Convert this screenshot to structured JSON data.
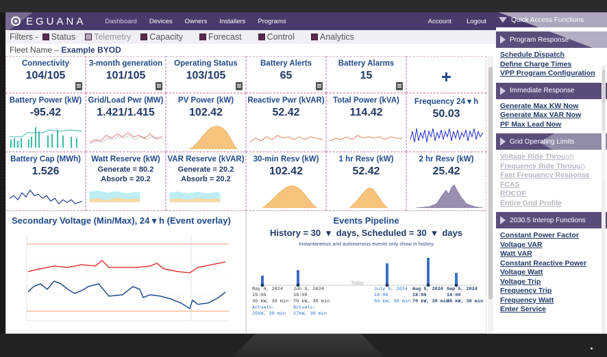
{
  "nav": {
    "logo": "EGUANA",
    "items": [
      "Dashboard",
      "Devices",
      "Owners",
      "Installers",
      "Programs"
    ],
    "account": "Account",
    "logout": "Logout"
  },
  "filters": {
    "label": "Filters -",
    "items": [
      {
        "label": "Status",
        "checked": true
      },
      {
        "label": "Telemetry",
        "checked": false
      },
      {
        "label": "Capacity",
        "checked": true
      },
      {
        "label": "Forecast",
        "checked": true
      },
      {
        "label": "Control",
        "checked": true
      },
      {
        "label": "Analytics",
        "checked": true
      }
    ]
  },
  "fleet": {
    "label": "Fleet Name –",
    "name": "Example BYOD"
  },
  "tiles_row1": [
    {
      "title": "Connectivity",
      "value": "104/105"
    },
    {
      "title": "3-month generation",
      "value": "101/105"
    },
    {
      "title": "Operating Status",
      "value": "103/105"
    },
    {
      "title": "Battery Alerts",
      "value": "65"
    },
    {
      "title": "Battery Alarms",
      "value": "15"
    },
    {
      "title": "",
      "value": "+"
    }
  ],
  "tiles_row2": [
    {
      "title": "Battery Power (kW)",
      "value": "-95.42"
    },
    {
      "title": "Grid/Load Pwr (MW)",
      "value": "1.421/1.415"
    },
    {
      "title": "PV Power (kW)",
      "value": "102.42"
    },
    {
      "title": "Reactive Pwr (kVAR)",
      "value": "52.42"
    },
    {
      "title": "Total Power (kVA)",
      "value": "114.42"
    },
    {
      "title": "Frequency 24 ▾ h",
      "value": "50.03"
    }
  ],
  "tiles_row3": [
    {
      "title": "Battery Cap (MWh)",
      "value": "1.526"
    },
    {
      "title": "Watt Reserve (kW)",
      "line1": "Generate = 80.2",
      "line2": "Absorb = 20.2"
    },
    {
      "title": "VAR Reserve (kVAR)",
      "line1": "Generate = 20.2",
      "line2": "Absorb = 20.2"
    },
    {
      "title": "30-min Resv (kW)",
      "value": "102.42"
    },
    {
      "title": "1 hr Resv (kW)",
      "value": "52.42"
    },
    {
      "title": "2 hr Resv (kW)",
      "value": "25.42"
    }
  ],
  "voltage_panel": {
    "title": "Secondary Voltage (Min/Max), 24 ▾ h (Event overlay)"
  },
  "events": {
    "title": "Events Pipeline",
    "history_label": "History = 30",
    "history_unit": "days, Scheduled = 30",
    "scheduled_unit": "days",
    "note": "Instantaneous and autonomous events only show in history",
    "today": "Today",
    "items": [
      {
        "date": "May 4, 2024",
        "time": "19:00",
        "detail": "30 kW, 30 min",
        "actuals_label": "Actuals:",
        "actuals": "25kW, 30 min"
      },
      {
        "date": "Jun 5, 2024",
        "time": "18:00",
        "detail": "70 kW, 30 min",
        "actuals_label": "Actuals:",
        "actuals": "27kW, 30 min"
      },
      {
        "date": "July 5, 2024",
        "time": "18:00",
        "detail": "50 kW, 30 min"
      },
      {
        "date": "Aug 5, 2024",
        "time": "18:00",
        "detail": "70 kW, 30 min"
      },
      {
        "date": "Sep 5, 2024",
        "time": "18:00",
        "detail": "30 kW, 30 min"
      }
    ]
  },
  "side": {
    "header": "Quick Access Functions",
    "sections": [
      {
        "title": "Program Response",
        "links": [
          {
            "label": "Schedule Dispatch",
            "faded": false
          },
          {
            "label": "Define Charge Times",
            "faded": false
          },
          {
            "label": "VPP Program Configuration",
            "faded": false
          }
        ]
      },
      {
        "title": "Immediate Response",
        "links": [
          {
            "label": "Generate Max KW Now",
            "faded": false
          },
          {
            "label": "Generate Max VAR Now",
            "faded": false
          },
          {
            "label": "PF Max Lead Now",
            "faded": false
          }
        ]
      },
      {
        "title": "Grid Operating Limits",
        "links": [
          {
            "label": "Voltage Ride Through",
            "faded": true
          },
          {
            "label": "Frequency Ride Through",
            "faded": true
          },
          {
            "label": "Fast Frequency Response",
            "faded": true
          },
          {
            "label": "FCAS",
            "faded": true
          },
          {
            "label": "ROCOF",
            "faded": true
          },
          {
            "label": "Entire Grid Profile",
            "faded": true
          }
        ]
      },
      {
        "title": "2030.5 Interop Functions",
        "links": [
          {
            "label": "Constant Power Factor",
            "faded": false
          },
          {
            "label": "Voltage VAR",
            "faded": false
          },
          {
            "label": "Watt VAR",
            "faded": false
          },
          {
            "label": "Constant Reactive Power",
            "faded": false
          },
          {
            "label": "Voltage Watt",
            "faded": false
          },
          {
            "label": "Voltage Trip",
            "faded": false
          },
          {
            "label": "Frequency Trip",
            "faded": false
          },
          {
            "label": "Frequency Watt",
            "faded": false
          },
          {
            "label": "Enter Service",
            "faded": false
          }
        ]
      }
    ]
  },
  "colors": {
    "nav": "#4a3a6b",
    "accent": "#1f4a8a",
    "area_fill": "#f7c47e",
    "purple_fill": "#9a8fb0",
    "cyan_fill": "#bdeef3",
    "red_series": "#e03a3a",
    "blue_series": "#1f4a8a"
  }
}
